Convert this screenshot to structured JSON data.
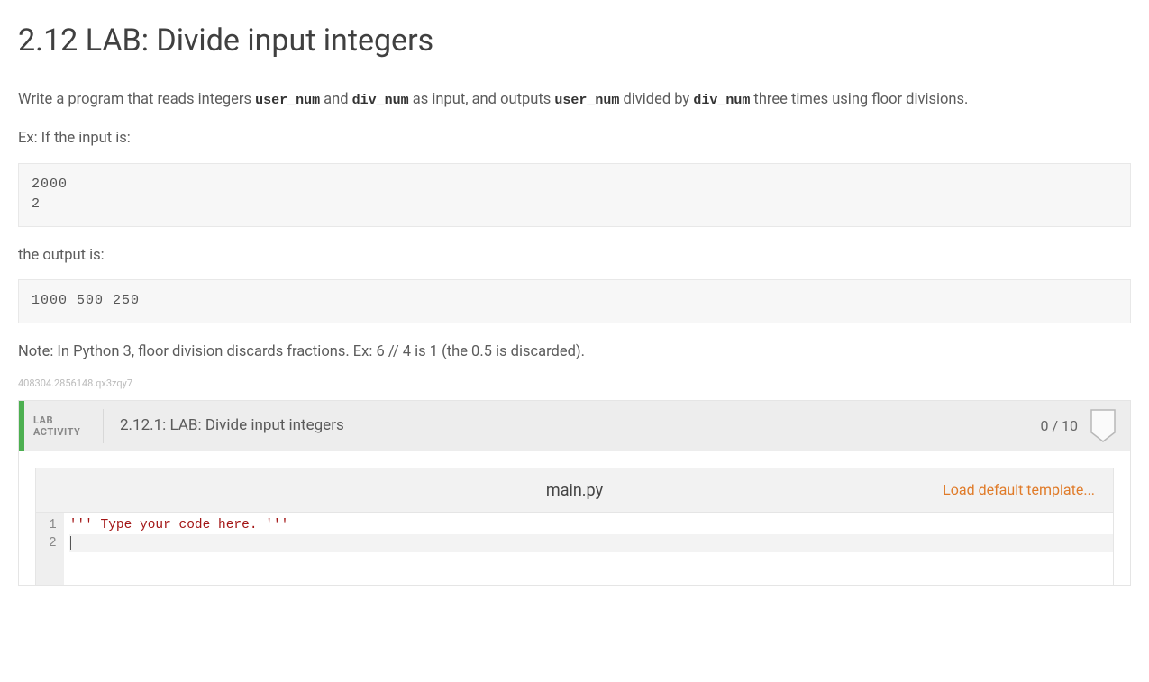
{
  "title": "2.12 LAB: Divide input integers",
  "desc": {
    "pre": "Write a program that reads integers ",
    "var1": "user_num",
    "mid1": " and ",
    "var2": "div_num",
    "mid2": " as input, and outputs ",
    "var3": "user_num",
    "mid3": " divided by ",
    "var4": "div_num",
    "post": " three times using floor divisions."
  },
  "labels": {
    "ex_input": "Ex: If the input is:",
    "ex_output": "the output is:"
  },
  "input_example": "2000\n2",
  "output_example": "1000 500 250",
  "note": "Note: In Python 3, floor division discards fractions. Ex: 6 // 4 is 1 (the 0.5 is discarded).",
  "tiny_id": "408304.2856148.qx3zqy7",
  "activity": {
    "type_line1": "LAB",
    "type_line2": "ACTIVITY",
    "title": "2.12.1: LAB: Divide input integers",
    "score": "0 / 10"
  },
  "editor": {
    "filename": "main.py",
    "load_template": "Load default template...",
    "gutter": [
      "1",
      "2"
    ],
    "line1": "''' Type your code here. '''"
  }
}
